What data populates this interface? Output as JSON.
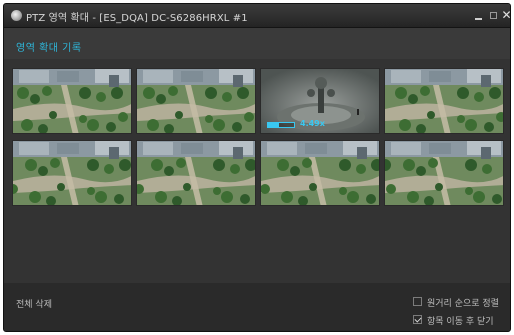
{
  "window": {
    "title": "PTZ 영역 확대 - [ES_DQA] DC-S6286HRXL #1",
    "app_icon": "camera-icon",
    "controls": {
      "minimize": "minimize-icon",
      "maximize": "maximize-icon",
      "close": "close-icon",
      "close_glyph": "✕"
    }
  },
  "header": {
    "title": "영역 확대 기록"
  },
  "history": {
    "items": [
      {
        "kind": "plaza"
      },
      {
        "kind": "plaza"
      },
      {
        "kind": "fountain",
        "zoom_label": "4.49x",
        "zoom_level": 0.42
      },
      {
        "kind": "plaza"
      },
      {
        "kind": "plaza"
      },
      {
        "kind": "plaza"
      },
      {
        "kind": "plaza"
      },
      {
        "kind": "plaza"
      }
    ]
  },
  "footer": {
    "delete_all": "전체 삭제",
    "sort_by_distance": {
      "label": "원거리 순으로 정렬",
      "checked": false
    },
    "close_after_move": {
      "label": "항목 이동 후 닫기",
      "checked": true
    }
  },
  "colors": {
    "accent": "#2fb5d8",
    "zoom": "#39c7f0",
    "background": "#333333"
  }
}
